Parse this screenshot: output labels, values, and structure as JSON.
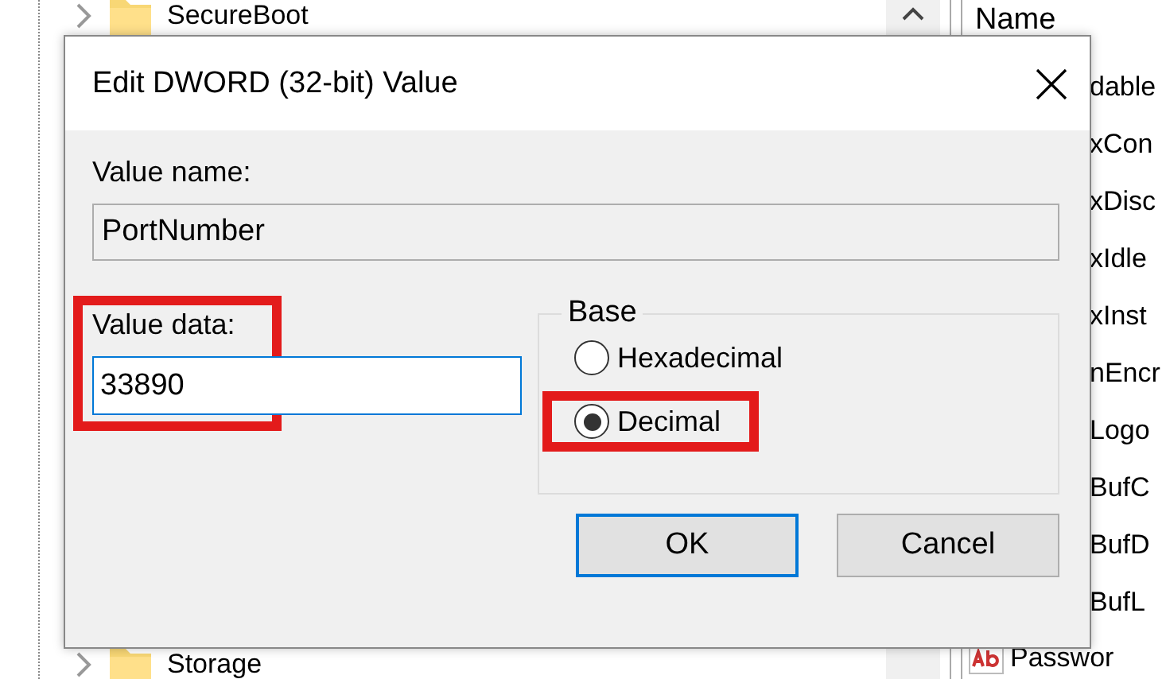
{
  "tree": {
    "items": [
      {
        "label": "SecureBoot",
        "expanded": false
      },
      {
        "label": "Storage",
        "expanded": false
      }
    ]
  },
  "list": {
    "column": "Name",
    "rows": [
      {
        "kind": "covered",
        "label": "dable"
      },
      {
        "kind": "covered",
        "label": "xCon"
      },
      {
        "kind": "covered",
        "label": "xDisc"
      },
      {
        "kind": "covered",
        "label": "xIdle"
      },
      {
        "kind": "covered",
        "label": "xInst"
      },
      {
        "kind": "covered",
        "label": "nEncr"
      },
      {
        "kind": "covered",
        "label": "Logo"
      },
      {
        "kind": "covered",
        "label": "BufC"
      },
      {
        "kind": "covered",
        "label": "BufD"
      },
      {
        "kind": "covered",
        "label": "BufL"
      },
      {
        "kind": "string",
        "label": "Passwor"
      }
    ]
  },
  "dialog": {
    "title": "Edit DWORD (32-bit) Value",
    "value_name": {
      "label": "Value name:",
      "value": "PortNumber"
    },
    "value_data": {
      "label": "Value data:",
      "value": "33890",
      "highlighted": true
    },
    "base": {
      "label": "Base",
      "options": [
        {
          "label": "Hexadecimal",
          "selected": false,
          "highlighted": false
        },
        {
          "label": "Decimal",
          "selected": true,
          "highlighted": true
        }
      ]
    },
    "buttons": [
      {
        "label": "OK",
        "default": true
      },
      {
        "label": "Cancel",
        "default": false
      }
    ]
  }
}
